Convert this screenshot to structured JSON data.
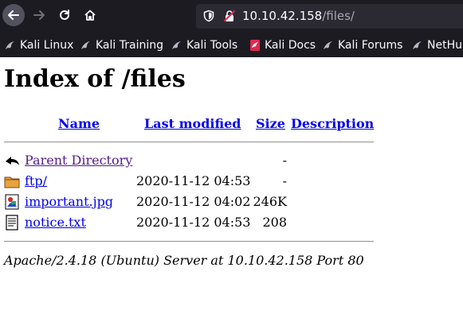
{
  "browser": {
    "url_host": "10.10.42.158",
    "url_path": "/files/",
    "bookmarks": [
      {
        "label": "Kali Linux",
        "icon": "kali-dragon-icon"
      },
      {
        "label": "Kali Training",
        "icon": "kali-dragon-icon"
      },
      {
        "label": "Kali Tools",
        "icon": "kali-dragon-icon"
      },
      {
        "label": "Kali Docs",
        "icon": "kali-docs-icon"
      },
      {
        "label": "Kali Forums",
        "icon": "kali-dragon-icon"
      },
      {
        "label": "NetHunter",
        "icon": "kali-dragon-icon"
      }
    ],
    "colors": {
      "chrome_bg": "#1c1b22",
      "urlbar_bg": "#2b2a33",
      "insecure_lock": "#e22850"
    }
  },
  "page": {
    "title": "Index of /files",
    "columns": {
      "name": "Name",
      "last_modified": "Last modified",
      "size": "Size",
      "description": "Description"
    },
    "rows": [
      {
        "icon": "back-arrow-icon",
        "name": "Parent Directory",
        "modified": "",
        "size": "-",
        "visited": true
      },
      {
        "icon": "folder-icon",
        "name": "ftp/",
        "modified": "2020-11-12 04:53",
        "size": "-",
        "visited": false
      },
      {
        "icon": "image-file-icon",
        "name": "important.jpg",
        "modified": "2020-11-12 04:02",
        "size": "246K",
        "visited": false
      },
      {
        "icon": "text-file-icon",
        "name": "notice.txt",
        "modified": "2020-11-12 04:53",
        "size": "208",
        "visited": false
      }
    ],
    "footer": "Apache/2.4.18 (Ubuntu) Server at 10.10.42.158 Port 80"
  }
}
